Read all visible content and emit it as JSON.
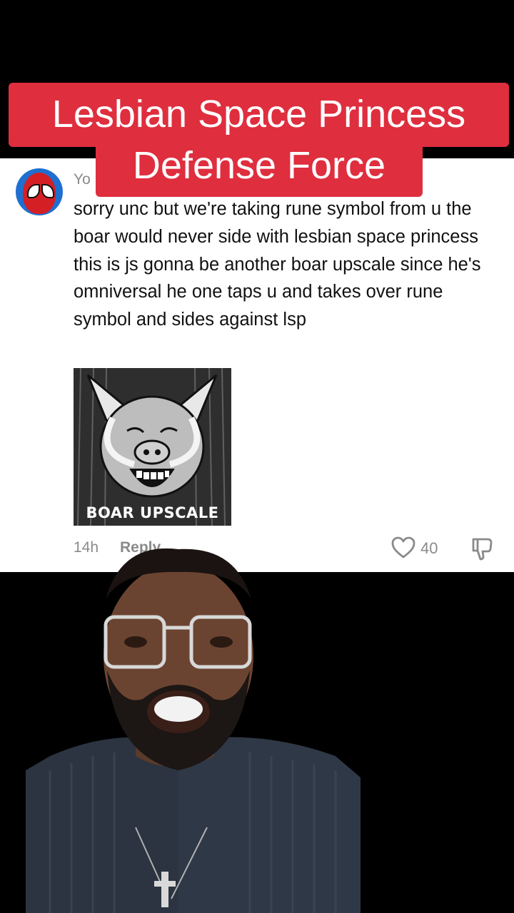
{
  "title": {
    "line1": "Lesbian Space Princess",
    "line2": "Defense Force"
  },
  "comment": {
    "username": "Yo",
    "text": "sorry unc but we're taking rune symbol from u the boar would never side with lesbian space princess this is js gonna be another boar upscale since he's omniversal he one taps u and takes over rune symbol and sides against lsp",
    "sticker_caption": "BOAR UPSCALE",
    "time": "14h",
    "reply_label": "Reply",
    "like_count": "40",
    "avatar_icon": "spiderman-avatar-icon",
    "like_icon": "heart-outline-icon",
    "dislike_icon": "thumbs-down-icon"
  },
  "colors": {
    "title_bg": "#df2e3e",
    "meta_gray": "#8a8a8a"
  }
}
